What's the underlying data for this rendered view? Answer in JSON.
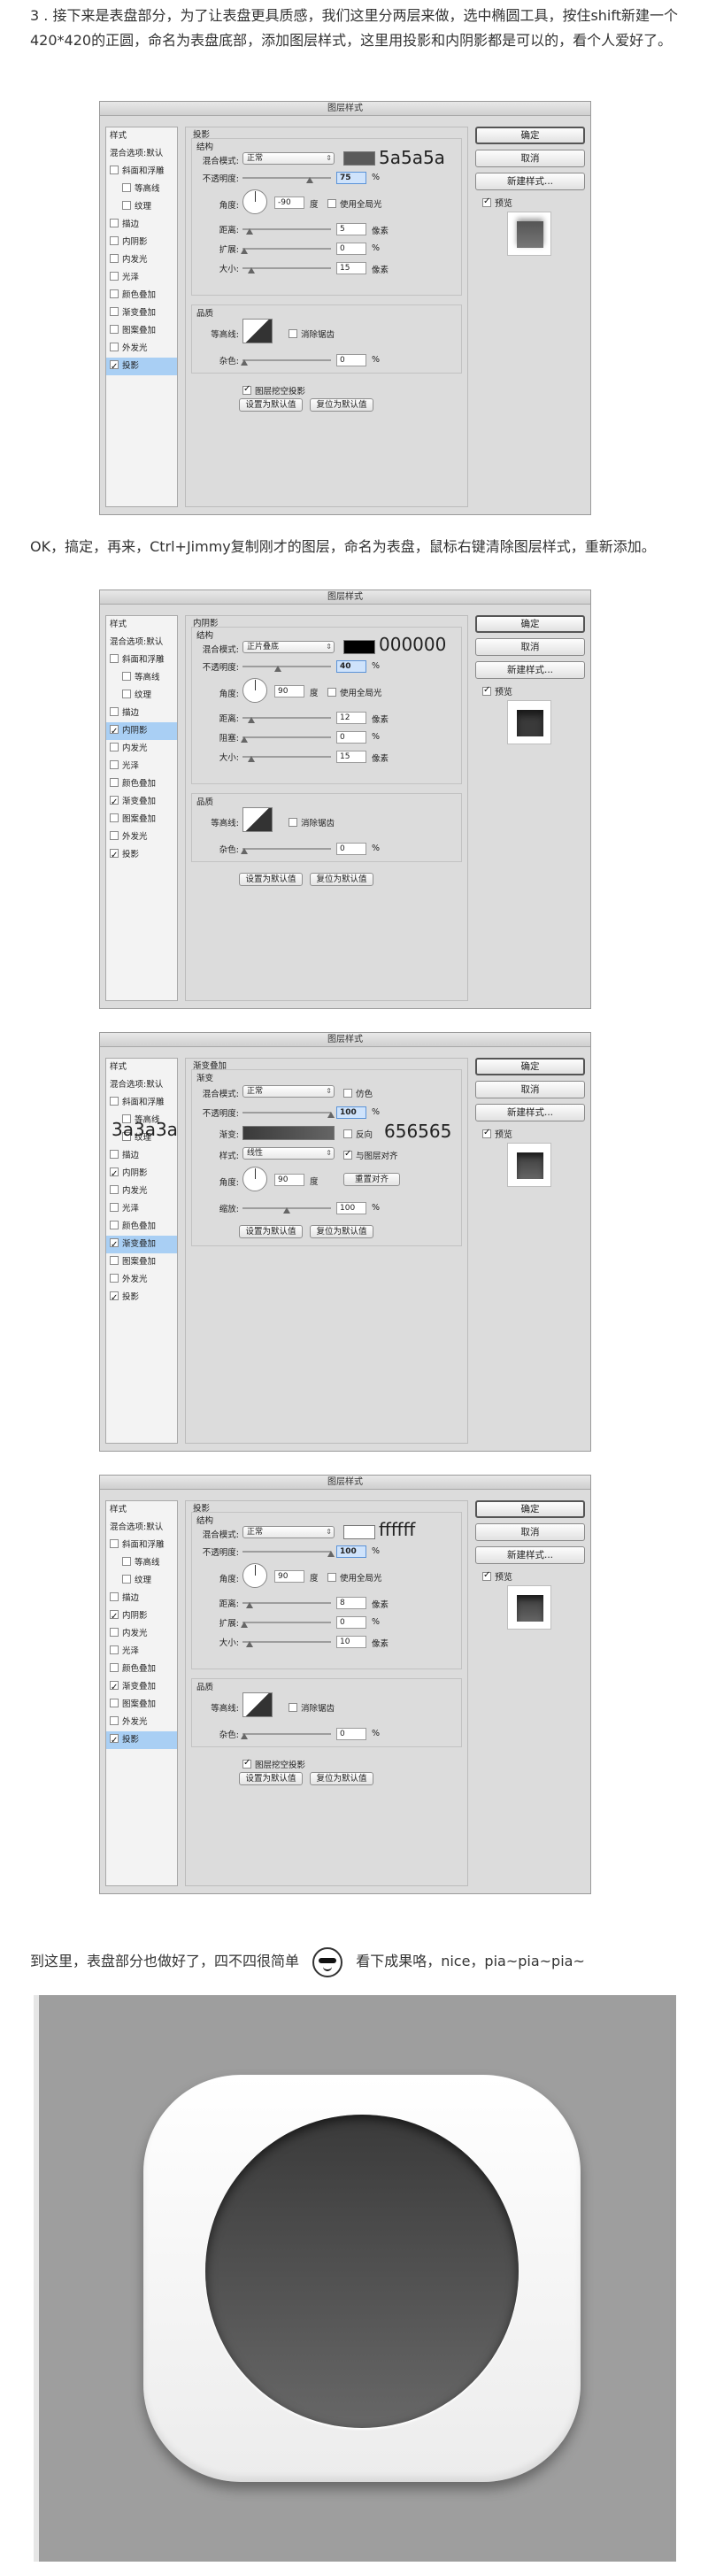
{
  "step3_text": "3 . 接下来是表盘部分，为了让表盘更具质感，我们这里分两层来做，选中椭圆工具，按住shift新建一个420*420的正圆，命名为表盘底部，添加图层样式，这里用投影和内阴影都是可以的，看个人爱好了。",
  "step4_text": "OK，搞定，再来，Ctrl+Jimmy复制刚才的图层，命名为表盘，鼠标右键清除图层样式，重新添加。",
  "final_text_before": "到这里，表盘部分也做好了，四不四很简单",
  "final_text_after": "看下成果咯，nice，pia~pia~pia~",
  "dialog_common": {
    "title": "图层样式",
    "ok": "确定",
    "cancel": "取消",
    "new_style": "新建样式...",
    "preview": "预览",
    "set_default": "设置为默认值",
    "reset_default": "复位为默认值",
    "sidebar_header": "样式",
    "sidebar_blend": "混合选项:默认",
    "blend_mode_label": "混合模式:",
    "opacity_label": "不透明度:",
    "angle_label": "角度:",
    "degree": "度",
    "global_light": "使用全局光",
    "distance_label": "距离:",
    "spread_label": "扩展:",
    "choke_label": "阻塞:",
    "size_label": "大小:",
    "px": "像素",
    "pct": "%",
    "quality": "品质",
    "contour_label": "等高线:",
    "antialias": "消除锯齿",
    "noise_label": "杂色:",
    "layer_knockout": "图层挖空投影",
    "structure": "结构"
  },
  "dialog1": {
    "section": "投影",
    "sidebar": [
      {
        "label": "斜面和浮雕",
        "checked": false,
        "sub": false
      },
      {
        "label": "等高线",
        "checked": false,
        "sub": true
      },
      {
        "label": "纹理",
        "checked": false,
        "sub": true
      },
      {
        "label": "描边",
        "checked": false,
        "sub": false
      },
      {
        "label": "内阴影",
        "checked": false,
        "sub": false
      },
      {
        "label": "内发光",
        "checked": false,
        "sub": false
      },
      {
        "label": "光泽",
        "checked": false,
        "sub": false
      },
      {
        "label": "颜色叠加",
        "checked": false,
        "sub": false
      },
      {
        "label": "渐变叠加",
        "checked": false,
        "sub": false
      },
      {
        "label": "图案叠加",
        "checked": false,
        "sub": false
      },
      {
        "label": "外发光",
        "checked": false,
        "sub": false
      },
      {
        "label": "投影",
        "checked": true,
        "sub": false
      }
    ],
    "blend_mode": "正常",
    "color": "#5a5a5a",
    "color_annot": "5a5a5a",
    "opacity": "75",
    "angle": "-90",
    "distance": "5",
    "spread": "0",
    "size": "15",
    "noise": "0"
  },
  "dialog2": {
    "section": "内阴影",
    "sidebar": [
      {
        "label": "斜面和浮雕",
        "checked": false,
        "sub": false
      },
      {
        "label": "等高线",
        "checked": false,
        "sub": true
      },
      {
        "label": "纹理",
        "checked": false,
        "sub": true
      },
      {
        "label": "描边",
        "checked": false,
        "sub": false
      },
      {
        "label": "内阴影",
        "checked": true,
        "sub": false
      },
      {
        "label": "内发光",
        "checked": false,
        "sub": false
      },
      {
        "label": "光泽",
        "checked": false,
        "sub": false
      },
      {
        "label": "颜色叠加",
        "checked": false,
        "sub": false
      },
      {
        "label": "渐变叠加",
        "checked": true,
        "sub": false
      },
      {
        "label": "图案叠加",
        "checked": false,
        "sub": false
      },
      {
        "label": "外发光",
        "checked": false,
        "sub": false
      },
      {
        "label": "投影",
        "checked": true,
        "sub": false
      }
    ],
    "blend_mode": "正片叠底",
    "color": "#000000",
    "color_annot": "000000",
    "opacity": "40",
    "angle": "90",
    "distance": "12",
    "choke": "0",
    "size": "15",
    "noise": "0"
  },
  "dialog3": {
    "section": "渐变叠加",
    "sub_section": "渐变",
    "sidebar": [
      {
        "label": "斜面和浮雕",
        "checked": false,
        "sub": false
      },
      {
        "label": "等高线",
        "checked": false,
        "sub": true
      },
      {
        "label": "纹理",
        "checked": false,
        "sub": true
      },
      {
        "label": "描边",
        "checked": false,
        "sub": false
      },
      {
        "label": "内阴影",
        "checked": true,
        "sub": false
      },
      {
        "label": "内发光",
        "checked": false,
        "sub": false
      },
      {
        "label": "光泽",
        "checked": false,
        "sub": false
      },
      {
        "label": "颜色叠加",
        "checked": false,
        "sub": false
      },
      {
        "label": "渐变叠加",
        "checked": true,
        "sub": false
      },
      {
        "label": "图案叠加",
        "checked": false,
        "sub": false
      },
      {
        "label": "外发光",
        "checked": false,
        "sub": false
      },
      {
        "label": "投影",
        "checked": true,
        "sub": false
      }
    ],
    "blend_mode": "正常",
    "dither": "仿色",
    "opacity": "100",
    "gradient_label": "渐变:",
    "reverse": "反向",
    "style_label": "样式:",
    "style": "线性",
    "align_layer": "与图层对齐",
    "reset_align": "重置对齐",
    "angle": "90",
    "scale_label": "缩放:",
    "scale": "100",
    "grad_left_annot": "3a3a3a",
    "grad_right_annot": "656565",
    "grad_left": "#3a3a3a",
    "grad_right": "#656565"
  },
  "dialog4": {
    "section": "投影",
    "sidebar": [
      {
        "label": "斜面和浮雕",
        "checked": false,
        "sub": false
      },
      {
        "label": "等高线",
        "checked": false,
        "sub": true
      },
      {
        "label": "纹理",
        "checked": false,
        "sub": true
      },
      {
        "label": "描边",
        "checked": false,
        "sub": false
      },
      {
        "label": "内阴影",
        "checked": true,
        "sub": false
      },
      {
        "label": "内发光",
        "checked": false,
        "sub": false
      },
      {
        "label": "光泽",
        "checked": false,
        "sub": false
      },
      {
        "label": "颜色叠加",
        "checked": false,
        "sub": false
      },
      {
        "label": "渐变叠加",
        "checked": true,
        "sub": false
      },
      {
        "label": "图案叠加",
        "checked": false,
        "sub": false
      },
      {
        "label": "外发光",
        "checked": false,
        "sub": false
      },
      {
        "label": "投影",
        "checked": true,
        "sub": false
      }
    ],
    "blend_mode": "正常",
    "color": "#ffffff",
    "color_annot": "ffffff",
    "opacity": "100",
    "angle": "90",
    "distance": "8",
    "spread": "0",
    "size": "10",
    "noise": "0"
  }
}
